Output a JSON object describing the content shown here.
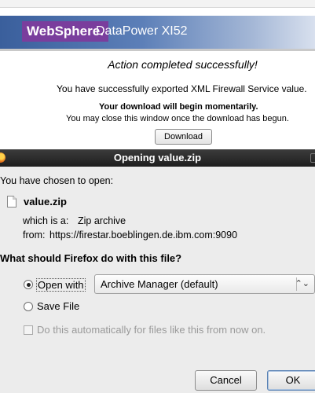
{
  "background_page": {
    "brand": "WebSphere.",
    "product": "DataPower XI52",
    "status_title": "Action completed successfully!",
    "export_message": "You have successfully exported XML Firewall Service value.",
    "download_notice": "Your download will begin momentarily.",
    "close_notice": "You may close this window once the download has begun.",
    "download_button": "Download"
  },
  "dialog": {
    "title": "Opening value.zip",
    "chosen_text": "You have chosen to open:",
    "filename": "value.zip",
    "which_is_label": "which is a:",
    "which_is_value": "Zip archive",
    "from_label": "from:",
    "from_value": "https://firestar.boeblingen.de.ibm.com:9090",
    "question": "What should Firefox do with this file?",
    "open_with_label": "Open with",
    "open_with_selected": "Archive Manager (default)",
    "save_file_label": "Save File",
    "auto_label": "Do this automatically for files like this from now on.",
    "cancel_button": "Cancel",
    "ok_button": "OK",
    "selected_option": "open_with",
    "auto_checked": false
  },
  "icons": {
    "title_icon": "firefox-icon",
    "file_icon": "file-icon",
    "dropdown_icon": "chevron-up-down-icon"
  },
  "colors": {
    "brand_purple": "#7a3e9d",
    "banner_blue": "#3a5f9c",
    "titlebar": "#2a2a2a",
    "dialog_bg": "#ececec"
  }
}
